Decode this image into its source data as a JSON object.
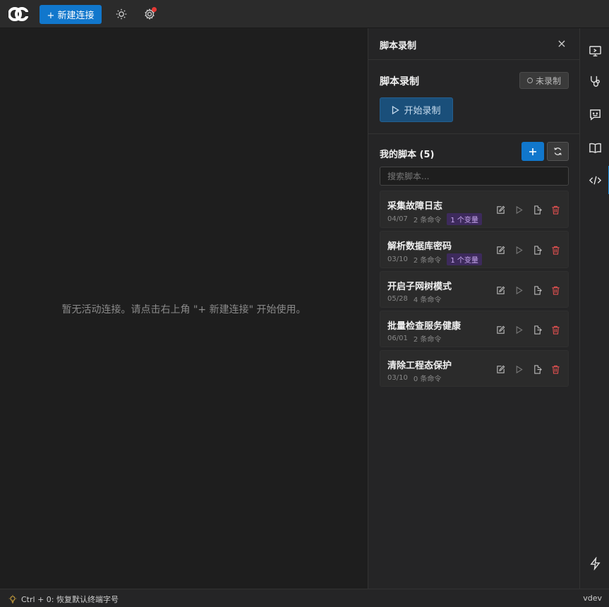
{
  "topbar": {
    "new_connection_label": "+ 新建连接"
  },
  "main": {
    "empty_message": "暂无活动连接。请点击右上角 \"+ 新建连接\" 开始使用。"
  },
  "panel": {
    "title": "脚本录制",
    "close_label": "×",
    "recording": {
      "title": "脚本录制",
      "status": "未录制",
      "start_label": "开始录制"
    },
    "scripts": {
      "heading": "我的脚本",
      "count": "(5)",
      "search_placeholder": "搜索脚本...",
      "items": [
        {
          "name": "采集故障日志",
          "date": "04/07",
          "commands": "2 条命令",
          "variables": "1 个变量"
        },
        {
          "name": "解析数据库密码",
          "date": "03/10",
          "commands": "2 条命令",
          "variables": "1 个变量"
        },
        {
          "name": "开启子网树模式",
          "date": "05/28",
          "commands": "4 条命令",
          "variables": ""
        },
        {
          "name": "批量检查服务健康",
          "date": "06/01",
          "commands": "2 条命令",
          "variables": ""
        },
        {
          "name": "清除工程态保护",
          "date": "03/10",
          "commands": "0 条命令",
          "variables": ""
        }
      ]
    }
  },
  "rail": {
    "items": [
      "monitor-icon",
      "stethoscope-icon",
      "chat-icon",
      "book-icon",
      "code-icon",
      "bolt-icon"
    ],
    "active": "code-icon"
  },
  "statusbar": {
    "hint": "Ctrl + 0: 恢复默认终端字号",
    "version": "vdev"
  },
  "colors": {
    "accent": "#1177cc",
    "danger": "#e05050",
    "variable_badge": "#3d2a5c"
  }
}
